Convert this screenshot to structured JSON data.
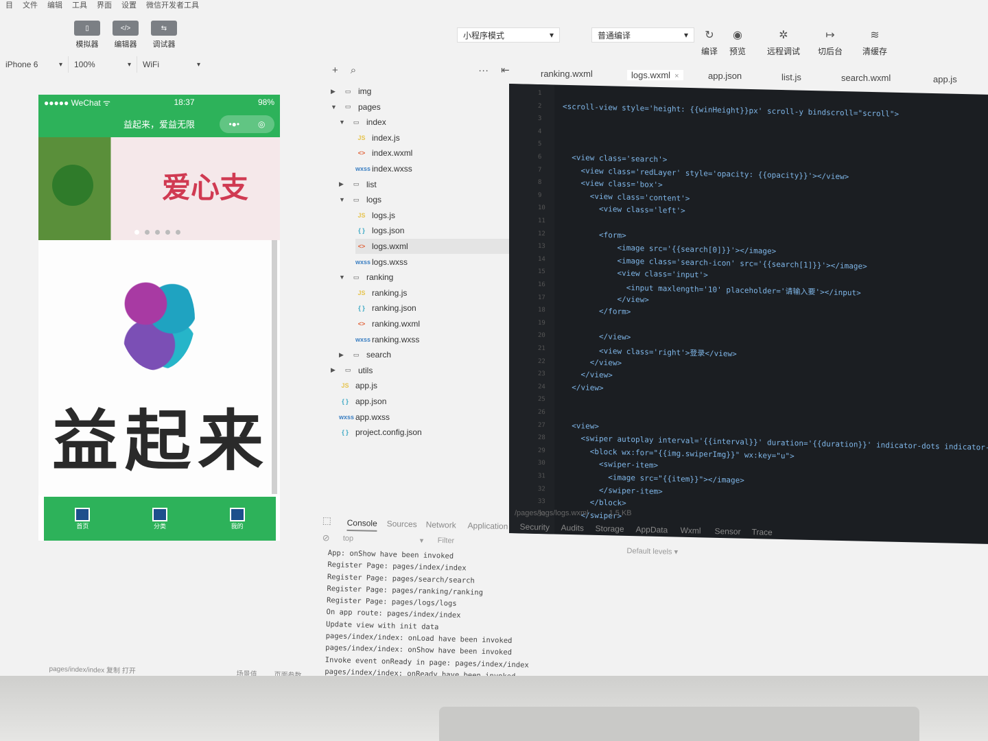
{
  "menu": [
    "目",
    "文件",
    "编辑",
    "工具",
    "界面",
    "设置",
    "微信开发者工具"
  ],
  "toolbar": {
    "left": [
      {
        "label": "模拟器",
        "glyph": "▯"
      },
      {
        "label": "编辑器",
        "glyph": "</>"
      },
      {
        "label": "调试器",
        "glyph": "⇆"
      }
    ],
    "mode": "小程序模式",
    "compile_mode": "普通编译",
    "right": [
      {
        "label": "编译",
        "icon": "refresh-icon",
        "glyph": "↻"
      },
      {
        "label": "预览",
        "icon": "eye-icon",
        "glyph": "◉"
      },
      {
        "label": "远程调试",
        "icon": "bug-icon",
        "glyph": "✲"
      },
      {
        "label": "切后台",
        "icon": "switch-icon",
        "glyph": "↦"
      },
      {
        "label": "清缓存",
        "icon": "layers-icon",
        "glyph": "≋"
      }
    ]
  },
  "device": {
    "model": "iPhone 6",
    "zoom": "100%",
    "network": "WiFi"
  },
  "simulator": {
    "carrier": "●●●●● WeChat ᯤ",
    "time": "18:37",
    "battery": "98%",
    "nav_title": "益起来，爱益无限",
    "capsule_more": "•●•",
    "capsule_close": "◎",
    "banner_text": "爱心支",
    "logo_text": "益起来",
    "tabs": [
      "首页",
      "分类",
      "我的"
    ]
  },
  "filetree": {
    "actions": {
      "add": "+",
      "search": "⌕",
      "more": "···",
      "collapse": "⇤"
    },
    "items": [
      {
        "label": "img",
        "type": "folder",
        "arrow": "▶",
        "indent": 0
      },
      {
        "label": "pages",
        "type": "folder",
        "arrow": "▼",
        "indent": 0
      },
      {
        "label": "index",
        "type": "folder",
        "arrow": "▼",
        "indent": 1
      },
      {
        "label": "index.js",
        "type": "js",
        "indent": 2
      },
      {
        "label": "index.wxml",
        "type": "wxml",
        "indent": 2
      },
      {
        "label": "index.wxss",
        "type": "wxss",
        "indent": 2
      },
      {
        "label": "list",
        "type": "folder",
        "arrow": "▶",
        "indent": 1
      },
      {
        "label": "logs",
        "type": "folder",
        "arrow": "▼",
        "indent": 1
      },
      {
        "label": "logs.js",
        "type": "js",
        "indent": 2
      },
      {
        "label": "logs.json",
        "type": "json",
        "indent": 2
      },
      {
        "label": "logs.wxml",
        "type": "wxml",
        "indent": 2,
        "selected": true
      },
      {
        "label": "logs.wxss",
        "type": "wxss",
        "indent": 2
      },
      {
        "label": "ranking",
        "type": "folder",
        "arrow": "▼",
        "indent": 1
      },
      {
        "label": "ranking.js",
        "type": "js",
        "indent": 2
      },
      {
        "label": "ranking.json",
        "type": "json",
        "indent": 2
      },
      {
        "label": "ranking.wxml",
        "type": "wxml",
        "indent": 2
      },
      {
        "label": "ranking.wxss",
        "type": "wxss",
        "indent": 2
      },
      {
        "label": "search",
        "type": "folder",
        "arrow": "▶",
        "indent": 1
      },
      {
        "label": "utils",
        "type": "folder",
        "arrow": "▶",
        "indent": 0
      },
      {
        "label": "app.js",
        "type": "js",
        "indent": 0
      },
      {
        "label": "app.json",
        "type": "json",
        "indent": 0
      },
      {
        "label": "app.wxss",
        "type": "wxss",
        "indent": 0
      },
      {
        "label": "project.config.json",
        "type": "json",
        "indent": 0
      }
    ]
  },
  "editor_tabs": [
    {
      "label": "ranking.wxml"
    },
    {
      "label": "logs.wxml",
      "active": true,
      "close": "×"
    },
    {
      "label": "app.json"
    },
    {
      "label": "list.js"
    },
    {
      "label": "search.wxml"
    },
    {
      "label": "app.js"
    }
  ],
  "code_lines": [
    {
      "n": "1",
      "text": ""
    },
    {
      "n": "2",
      "text": "<scroll-view style='height: {{winHeight}}px' scroll-y bindscroll=\"scroll\">"
    },
    {
      "n": "3",
      "text": ""
    },
    {
      "n": "4",
      "text": ""
    },
    {
      "n": "5",
      "text": ""
    },
    {
      "n": "6",
      "text": "  <view class='search'>"
    },
    {
      "n": "7",
      "text": "    <view class='redLayer' style='opacity: {{opacity}}'></view>"
    },
    {
      "n": "8",
      "text": "    <view class='box'>"
    },
    {
      "n": "9",
      "text": "      <view class='content'>"
    },
    {
      "n": "10",
      "text": "        <view class='left'>"
    },
    {
      "n": "11",
      "text": ""
    },
    {
      "n": "12",
      "text": "        <form>"
    },
    {
      "n": "13",
      "text": "            <image src='{{search[0]}}'></image>"
    },
    {
      "n": "14",
      "text": "            <image class='search-icon' src='{{search[1]}}'></image>"
    },
    {
      "n": "15",
      "text": "            <view class='input'>"
    },
    {
      "n": "16",
      "text": "              <input maxlength='10' placeholder='请输入要'></input>"
    },
    {
      "n": "17",
      "text": "            </view>"
    },
    {
      "n": "18",
      "text": "        </form>"
    },
    {
      "n": "19",
      "text": ""
    },
    {
      "n": "20",
      "text": "        </view>"
    },
    {
      "n": "21",
      "text": "        <view class='right'>登录</view>"
    },
    {
      "n": "22",
      "text": "      </view>"
    },
    {
      "n": "23",
      "text": "    </view>"
    },
    {
      "n": "24",
      "text": "  </view>"
    },
    {
      "n": "25",
      "text": ""
    },
    {
      "n": "26",
      "text": ""
    },
    {
      "n": "27",
      "text": "  <view>"
    },
    {
      "n": "28",
      "text": "    <swiper autoplay interval='{{interval}}' duration='{{duration}}' indicator-dots indicator-a"
    },
    {
      "n": "29",
      "text": "      <block wx:for=\"{{img.swiperImg}}\" wx:key=\"u\">"
    },
    {
      "n": "30",
      "text": "        <swiper-item>"
    },
    {
      "n": "31",
      "text": "          <image src=\"{{item}}\"></image>"
    },
    {
      "n": "32",
      "text": "        </swiper-item>"
    },
    {
      "n": "33",
      "text": "      </block>"
    },
    {
      "n": "34",
      "text": "    </swiper>"
    }
  ],
  "file_path": "/pages/logs/logs.wxml",
  "file_size": "1.5 KB",
  "devtools": {
    "tabs": [
      "Console",
      "Sources",
      "Network",
      "Application",
      "Security",
      "Audits",
      "Storage",
      "AppData",
      "Wxml",
      "Sensor",
      "Trace"
    ],
    "context": "top",
    "filter_placeholder": "Filter",
    "levels": "Default levels ▾",
    "logs": [
      "App: onShow have been invoked",
      "Register Page: pages/index/index",
      "Register Page: pages/search/search",
      "Register Page: pages/ranking/ranking",
      "Register Page: pages/logs/logs",
      "On app route: pages/index/index",
      "Update view with init data",
      "pages/index/index: onLoad have been invoked",
      "pages/index/index: onShow have been invoked",
      "Invoke event onReady in page: pages/index/index",
      "pages/index/index: onReady have been invoked"
    ]
  },
  "statusbar": {
    "page_path": "pages/index/index 复制 打开",
    "scene": "场景值",
    "params": "页面参数"
  }
}
